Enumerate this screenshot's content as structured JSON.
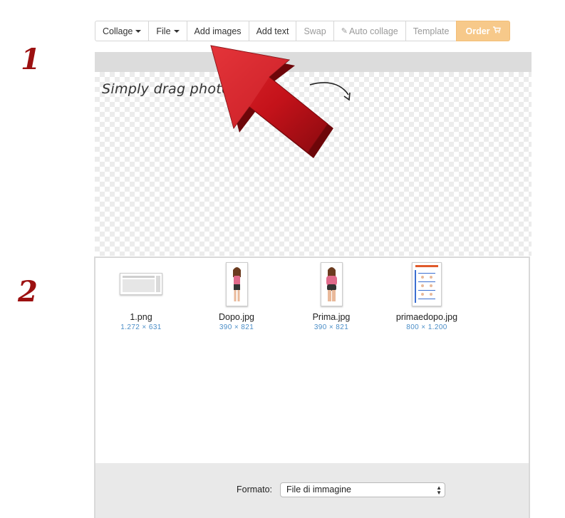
{
  "toolbar": {
    "collage": "Collage",
    "file": "File",
    "add_images": "Add images",
    "add_text": "Add text",
    "swap": "Swap",
    "auto_collage": "Auto collage",
    "template": "Template",
    "order": "Order"
  },
  "steps": [
    "1",
    "2"
  ],
  "canvas": {
    "hint": "Simply drag photos           ies"
  },
  "files": [
    {
      "name": "1.png",
      "dims": "1.272 × 631"
    },
    {
      "name": "Dopo.jpg",
      "dims": "390 × 821"
    },
    {
      "name": "Prima.jpg",
      "dims": "390 × 821"
    },
    {
      "name": "primaedopo.jpg",
      "dims": "800 × 1.200"
    }
  ],
  "format": {
    "label": "Formato:",
    "selected": "File di immagine"
  },
  "colors": {
    "accent_order": "#f7c98a",
    "step_red": "#9c1010",
    "arrow_red": "#c4121a",
    "dims_blue": "#4a8dc7"
  },
  "icons": [
    "caret-down-icon",
    "wand-icon",
    "cart-icon",
    "curved-arrow-icon",
    "big-red-arrow-icon",
    "select-chevrons-icon"
  ]
}
